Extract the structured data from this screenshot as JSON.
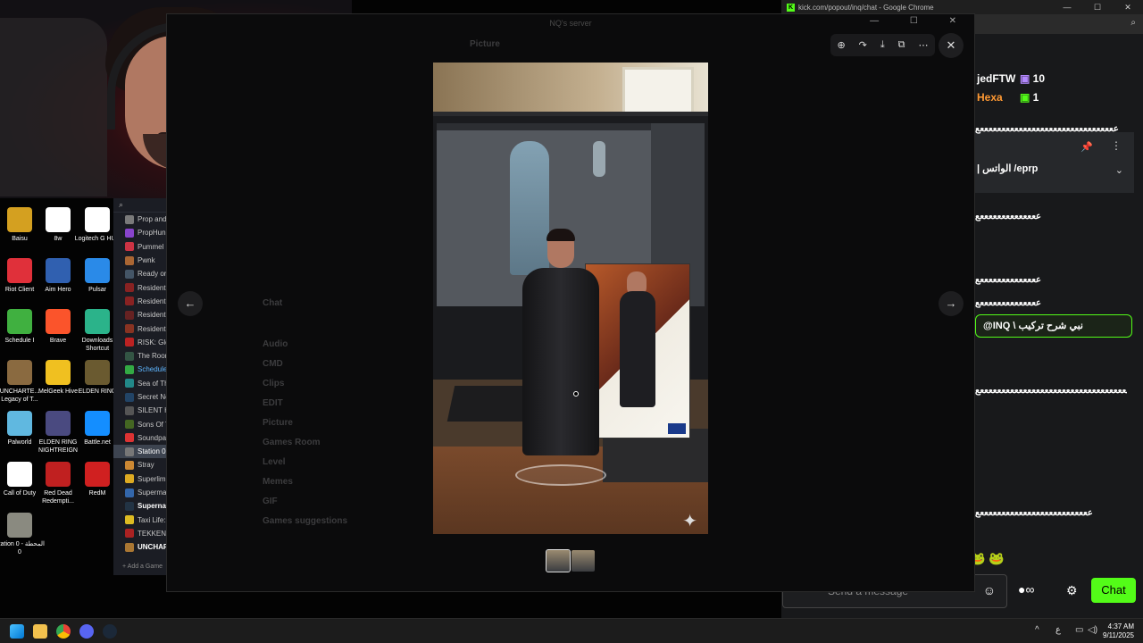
{
  "chrome": {
    "title": "kick.com/popout/inq/chat - Google Chrome",
    "min": "—",
    "max": "☐",
    "close": "✕",
    "search_icon": "search-icon"
  },
  "desktop_icons": [
    {
      "label": "Baisu",
      "color": "#d4a020"
    },
    {
      "label": "8w",
      "color": "#ffffff"
    },
    {
      "label": "Logitech G HUB",
      "color": "#ffffff"
    },
    {
      "label": "Riot Client",
      "color": "#e0303a"
    },
    {
      "label": "Aim Hero",
      "color": "#3060b0"
    },
    {
      "label": "Pulsar",
      "color": "#2a8ae8"
    },
    {
      "label": "Schedule I",
      "color": "#40b040"
    },
    {
      "label": "Brave",
      "color": "#fb542b"
    },
    {
      "label": "Downloads Shortcut",
      "color": "#2bb38a"
    },
    {
      "label": "UNCHARTE... Legacy of T...",
      "color": "#8a6a40"
    },
    {
      "label": "MelGeek Hive",
      "color": "#f0c020"
    },
    {
      "label": "ELDEN RING",
      "color": "#6a5a30"
    },
    {
      "label": "Palworld",
      "color": "#60b8e0"
    },
    {
      "label": "ELDEN RING NIGHTREIGN",
      "color": "#4a4a80"
    },
    {
      "label": "Battle.net",
      "color": "#148eff"
    },
    {
      "label": "Call of Duty",
      "color": "#ffffff"
    },
    {
      "label": "Red Dead Redempti...",
      "color": "#c02020"
    },
    {
      "label": "RedM",
      "color": "#d02020"
    },
    {
      "label": "Station 0 - المحطة 0",
      "color": "#8a8a80"
    }
  ],
  "steam_games": [
    {
      "name": "Prop and",
      "color": "#7a7a7a"
    },
    {
      "name": "PropHun",
      "color": "#8844cc"
    },
    {
      "name": "Pummel P",
      "color": "#cc3344"
    },
    {
      "name": "Pwnk",
      "color": "#aa6633"
    },
    {
      "name": "Ready or",
      "color": "#445566"
    },
    {
      "name": "Resident",
      "color": "#882222"
    },
    {
      "name": "Resident",
      "color": "#882222"
    },
    {
      "name": "Resident",
      "color": "#662222"
    },
    {
      "name": "Resident",
      "color": "#883322"
    },
    {
      "name": "RISK: Glo",
      "color": "#bb2222"
    },
    {
      "name": "The Roon",
      "color": "#335544"
    },
    {
      "name": "Schedule",
      "color": "#33aa44",
      "style": "blue"
    },
    {
      "name": "Sea of Th",
      "color": "#228888"
    },
    {
      "name": "Secret Ne",
      "color": "#224466"
    },
    {
      "name": "SILENT H",
      "color": "#555555"
    },
    {
      "name": "Sons Of T",
      "color": "#446622"
    },
    {
      "name": "Soundpa",
      "color": "#dd3333"
    },
    {
      "name": "Station 0",
      "color": "#777777",
      "style": "active"
    },
    {
      "name": "Stray",
      "color": "#cc8833"
    },
    {
      "name": "Superlim",
      "color": "#ddaa22"
    },
    {
      "name": "Superma",
      "color": "#3366aa"
    },
    {
      "name": "Supernat",
      "color": "#223344",
      "style": "bold"
    },
    {
      "name": "Taxi Life:",
      "color": "#ddbb22"
    },
    {
      "name": "TEKKEN 8",
      "color": "#aa2222"
    },
    {
      "name": "UNCHAR",
      "color": "#aa7733",
      "style": "bold"
    }
  ],
  "steam": {
    "add_game": "Add a Game"
  },
  "discord": {
    "title": "NQ's server",
    "current_channel": "Picture",
    "channels": [
      "Chat",
      "Audio",
      "CMD",
      "Clips",
      "EDIT",
      "Picture",
      "Games Room",
      "Level",
      "Memes",
      "GIF",
      "Games suggestions"
    ]
  },
  "media_viewer": {
    "zoom_icon": "⊕",
    "rotate_icon": "↷",
    "download_icon": "⤓",
    "open_icon": "⧉",
    "more_icon": "⋯",
    "close_icon": "✕",
    "prev_icon": "←",
    "next_icon": "→",
    "spark_icon": "✦",
    "thumbnail_count": 2
  },
  "kick_chat": {
    "users": [
      {
        "name": "jedFTW",
        "color": "#ffffff",
        "badge": "10",
        "badge_color": "#b388ff"
      },
      {
        "name": "Hexa",
        "color": "#ff9933",
        "badge": "1",
        "badge_color": "#53fc18"
      }
    ],
    "pinned_text": "| الواتس /eprp",
    "pin_icon": "📌",
    "more_icon": "⋮",
    "chevron_icon": "⌄",
    "messages": [
      "ععععععععععععععععععععععععععععععععع",
      "ععععععععععععععع",
      "ععععععععععععععع",
      "ععععععععععععععع",
      "ععععععععععععععععععععععععععععععععععععع",
      "ععععععععععععععععععععععععععع"
    ],
    "mention_text": "@INQ \\ نبي شرح تركيب",
    "emotes": "🐸 🐸",
    "input_placeholder": "Send a message",
    "smile_icon": "☺",
    "kicks_icon": "∞",
    "settings_icon": "⚙",
    "chat_button": "Chat"
  },
  "taskbar": {
    "time": "4:37 AM",
    "date": "9/11/2025",
    "lang": "ع",
    "tray_up": "^"
  }
}
